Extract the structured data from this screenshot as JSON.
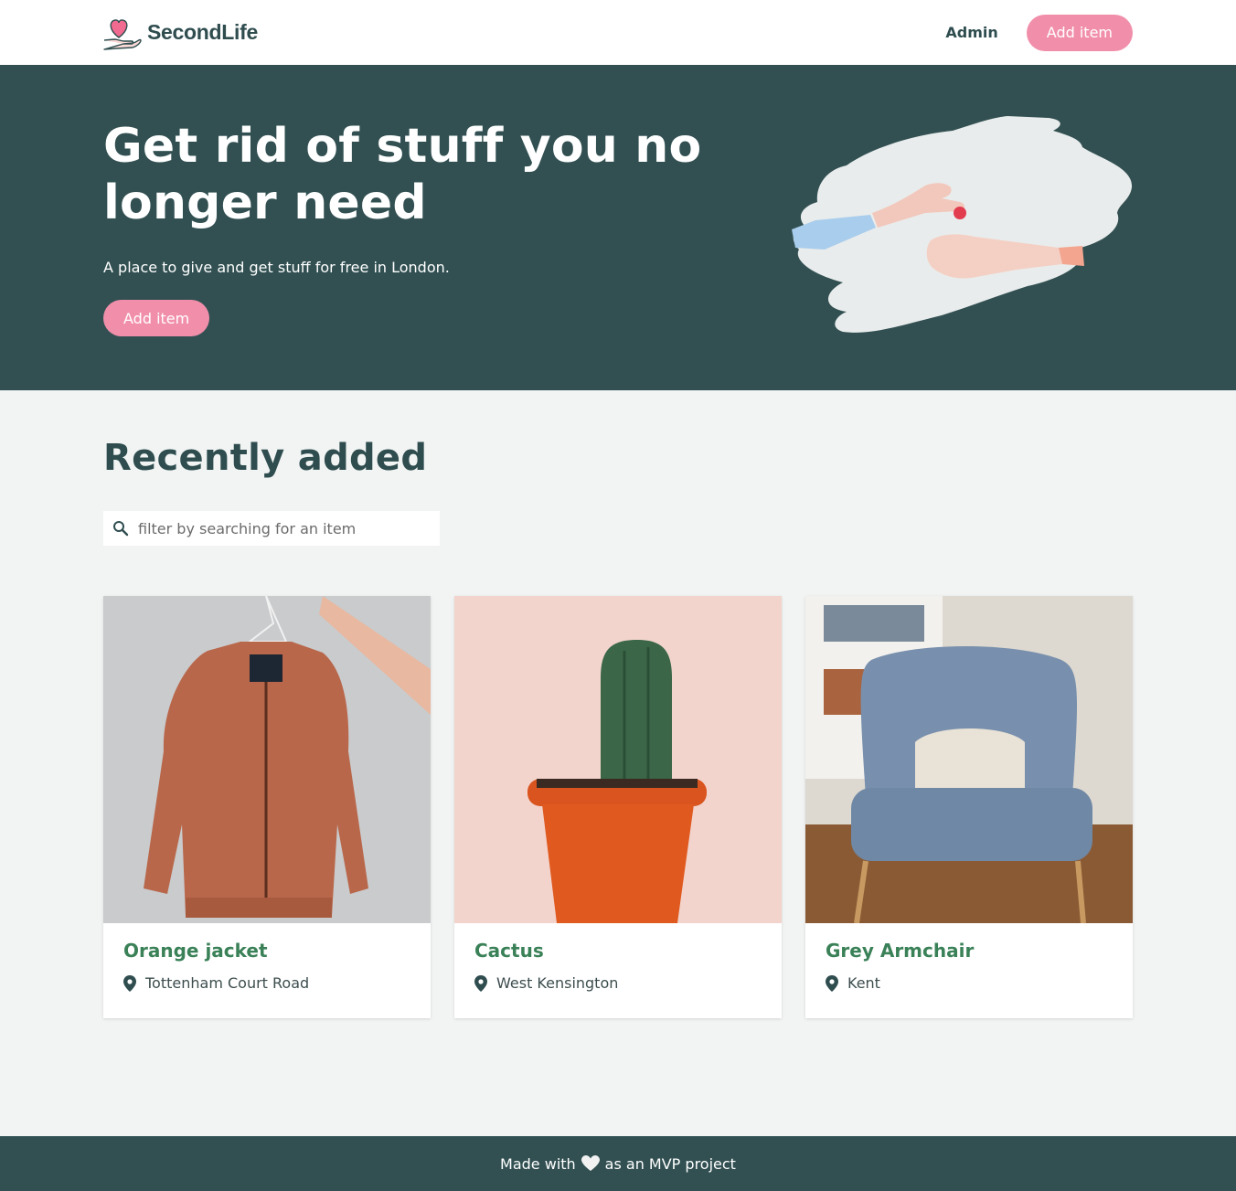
{
  "nav": {
    "brand_name": "SecondLife",
    "admin_label": "Admin",
    "add_item_label": "Add item"
  },
  "hero": {
    "title": "Get rid of stuff you no longer need",
    "subtitle": "A place to give and get stuff for free in London.",
    "button_label": "Add item"
  },
  "recent": {
    "title": "Recently added",
    "search_placeholder": "filter by searching for an item",
    "items": [
      {
        "title": "Orange jacket",
        "location": "Tottenham Court Road"
      },
      {
        "title": "Cactus",
        "location": "West Kensington"
      },
      {
        "title": "Grey Armchair",
        "location": "Kent"
      }
    ]
  },
  "footer": {
    "text_before": "Made with",
    "text_after": "as an MVP project"
  },
  "colors": {
    "dark_teal": "#325052",
    "pink_accent": "#f18fab",
    "item_title_green": "#3a8158",
    "background": "#f1f4f3"
  },
  "icons": [
    "heart-hand-logo-icon",
    "search-icon",
    "location-pin-icon",
    "heart-icon"
  ]
}
